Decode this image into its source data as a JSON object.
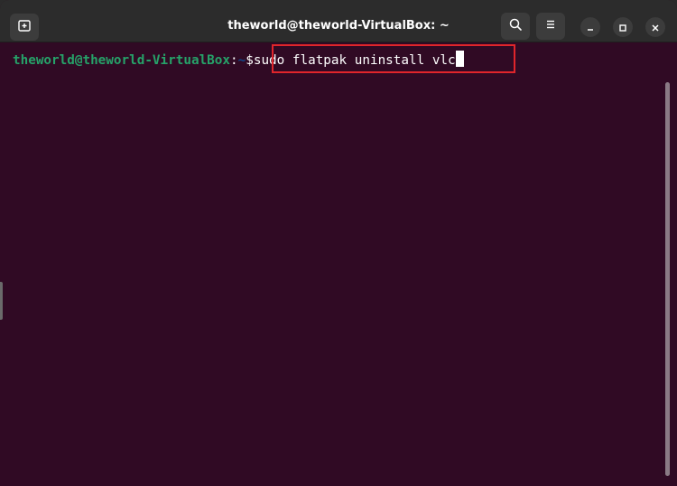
{
  "window": {
    "title": "theworld@theworld-VirtualBox: ~"
  },
  "titlebar": {
    "new_tab_icon": "new-tab-icon",
    "search_icon": "search-icon",
    "menu_icon": "hamburger-menu-icon",
    "minimize_icon": "minimize-icon",
    "maximize_icon": "maximize-icon",
    "close_icon": "close-icon"
  },
  "terminal": {
    "prompt_user_host": "theworld@theworld-VirtualBox",
    "prompt_colon": ":",
    "prompt_path": "~",
    "prompt_symbol": "$",
    "command": "sudo flatpak uninstall vlc"
  },
  "colors": {
    "terminal_bg": "#300a24",
    "prompt_user": "#26a269",
    "prompt_path": "#12488b",
    "highlight": "#e0252b",
    "titlebar_bg": "#2c2c2c"
  }
}
